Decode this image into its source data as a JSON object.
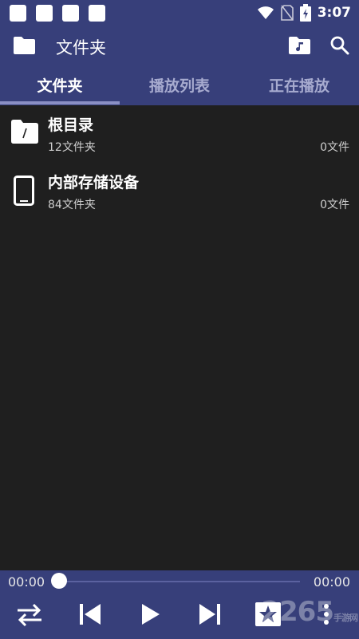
{
  "status": {
    "time": "3:07"
  },
  "app_bar": {
    "title": "文件夹"
  },
  "tabs": [
    {
      "label": "文件夹"
    },
    {
      "label": "播放列表"
    },
    {
      "label": "正在播放"
    }
  ],
  "list": [
    {
      "title": "根目录",
      "subtitle": "12文件夹",
      "right": "0文件"
    },
    {
      "title": "内部存储设备",
      "subtitle": "84文件夹",
      "right": "0文件"
    }
  ],
  "player": {
    "elapsed": "00:00",
    "total": "00:00",
    "progress": 0
  },
  "watermark": {
    "main": "2265",
    "sub": "手游网"
  }
}
